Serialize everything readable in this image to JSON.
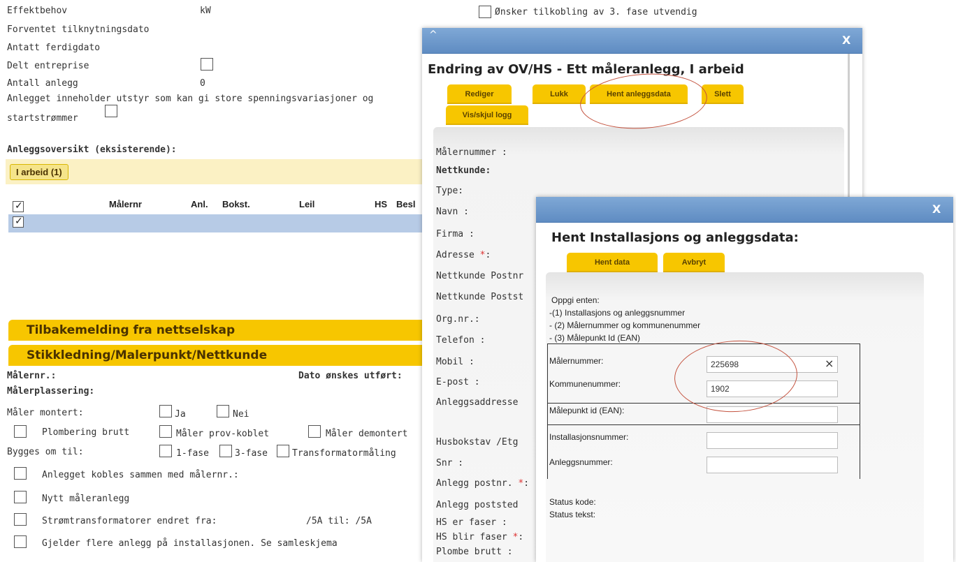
{
  "bg_form": {
    "rows": {
      "effektbehov": "Effektbehov",
      "effektbehov_unit": "kW",
      "forventet": "Forventet tilknytningsdato",
      "antatt": "Antatt ferdigdato",
      "delt": "Delt entreprise",
      "antall": "Antall anlegg",
      "antall_value": "0",
      "utstyr_line1": "Anlegget inneholder utstyr som kan gi store spenningsvariasjoner og",
      "utstyr_line2": "startstrømmer",
      "onsker": "Ønsker tilkobling av 3. fase utvendig"
    },
    "overview_title": "Anleggsoversikt (eksisterende):",
    "overview_tab": "I arbeid (1)",
    "columns": [
      "Målernr",
      "Anl.",
      "Bokst.",
      "Leil",
      "HS",
      "Besl"
    ],
    "section_tilbake": "Tilbakemelding fra nettselskap",
    "section_stikk": "Stikkledning/Malerpunkt/Nettkunde",
    "malernr": "Målernr.:",
    "dato": "Dato ønskes utført:",
    "malerplassering": "Målerplassering:",
    "maler_montert": "Måler montert:",
    "ja": "Ja",
    "nei": "Nei",
    "plombering": "Plombering brutt",
    "prov_koblet": "Måler prov-koblet",
    "demontert": "Måler demontert",
    "bygges": "Bygges om til:",
    "fase1": "1-fase",
    "fase3": "3-fase",
    "transformator": "Transformatormåling",
    "kobles": "Anlegget kobles sammen med målernr.:",
    "nytt": "Nytt måleranlegg",
    "stromtrafo": "Strømtransformatorer endret fra:",
    "stromtrafo_val": "/5A til: /5A",
    "gjelder": "Gjelder flere anlegg på installasjonen. Se samleskjema"
  },
  "dialog1": {
    "caret": "^",
    "close": "X",
    "title": "Endring av OV/HS - Ett måleranlegg, I arbeid",
    "tabs": [
      "Rediger",
      "Lukk",
      "Hent anleggsdata",
      "Slett",
      "Vis/skjul logg"
    ],
    "labels": {
      "malernummer": "Målernummer :",
      "nettkunde": "Nettkunde:",
      "type": "Type:",
      "navn": "Navn :",
      "firma": "Firma :",
      "adresse": "Adresse",
      "postnr": "Nettkunde Postnr",
      "poststed": "Nettkunde Postst",
      "orgnr": "Org.nr.:",
      "telefon": "Telefon :",
      "mobil": "Mobil :",
      "epost": "E-post :",
      "anleggsaddresse": "Anleggsaddresse",
      "husbokstav": "Husbokstav /Etg",
      "snr": "Snr :",
      "anlegg_postnr": "Anlegg postnr.",
      "anlegg_poststed": "Anlegg poststed",
      "hs_er": "HS er faser :",
      "hs_blir": "HS blir faser",
      "plombe": "Plombe brutt :"
    },
    "required_mark": "*",
    "colon": ":"
  },
  "dialog2": {
    "close": "X",
    "title": "Hent Installasjons og anleggsdata:",
    "tabs": [
      "Hent data",
      "Avbryt"
    ],
    "instructions": [
      "Oppgi enten:",
      "-(1) Installasjons og anleggsnummer",
      "- (2) Målernummer og kommunenummer",
      "- (3) Målepunkt Id (EAN)"
    ],
    "fields": {
      "malernummer_label": "Målernummer:",
      "malernummer_value": "225698",
      "clear": "×",
      "kommunenummer_label": "Kommunenummer:",
      "kommunenummer_value": "1902",
      "malepunkt_label": "Målepunkt id (EAN):",
      "malepunkt_value": "",
      "installasjon_label": "Installasjonsnummer:",
      "installasjon_value": "",
      "anlegg_label": "Anleggsnummer:",
      "anlegg_value": ""
    },
    "status_kode": "Status kode:",
    "status_tekst": "Status tekst:"
  },
  "colors": {
    "accent": "#f7c600",
    "dialog_header": "#6f9acc",
    "highlight_row": "#b7cbe6",
    "annotation_ring": "#c4533f"
  }
}
